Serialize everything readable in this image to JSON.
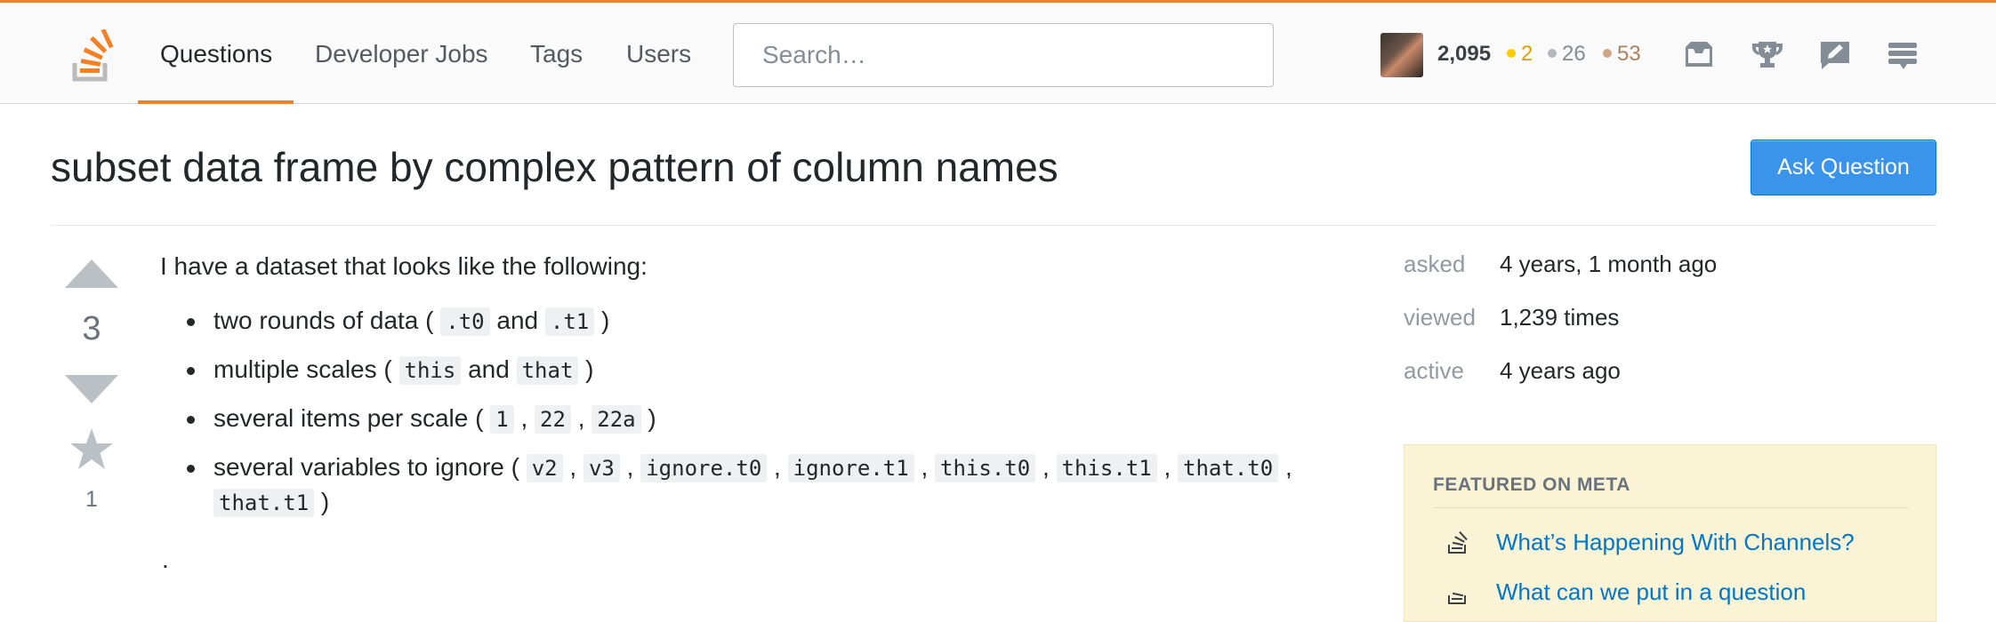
{
  "nav": {
    "items": [
      {
        "label": "Questions"
      },
      {
        "label": "Developer Jobs"
      },
      {
        "label": "Tags"
      },
      {
        "label": "Users"
      }
    ],
    "search_placeholder": "Search…",
    "user": {
      "reputation": "2,095",
      "gold": "2",
      "silver": "26",
      "bronze": "53"
    }
  },
  "question": {
    "title": "subset data frame by complex pattern of column names",
    "ask_button": "Ask Question",
    "votes": "3",
    "favorites": "1",
    "intro": "I have a dataset that looks like the following:",
    "bullets": [
      {
        "parts": [
          {
            "t": "text",
            "v": "two rounds of data ( "
          },
          {
            "t": "code",
            "v": ".t0"
          },
          {
            "t": "text",
            "v": " and "
          },
          {
            "t": "code",
            "v": ".t1"
          },
          {
            "t": "text",
            "v": " )"
          }
        ]
      },
      {
        "parts": [
          {
            "t": "text",
            "v": "multiple scales ( "
          },
          {
            "t": "code",
            "v": "this"
          },
          {
            "t": "text",
            "v": " and "
          },
          {
            "t": "code",
            "v": "that"
          },
          {
            "t": "text",
            "v": " )"
          }
        ]
      },
      {
        "parts": [
          {
            "t": "text",
            "v": "several items per scale ( "
          },
          {
            "t": "code",
            "v": "1"
          },
          {
            "t": "text",
            "v": " , "
          },
          {
            "t": "code",
            "v": "22"
          },
          {
            "t": "text",
            "v": " , "
          },
          {
            "t": "code",
            "v": "22a"
          },
          {
            "t": "text",
            "v": " )"
          }
        ]
      },
      {
        "parts": [
          {
            "t": "text",
            "v": "several variables to ignore ( "
          },
          {
            "t": "code",
            "v": "v2"
          },
          {
            "t": "text",
            "v": " , "
          },
          {
            "t": "code",
            "v": "v3"
          },
          {
            "t": "text",
            "v": " , "
          },
          {
            "t": "code",
            "v": "ignore.t0"
          },
          {
            "t": "text",
            "v": " , "
          },
          {
            "t": "code",
            "v": "ignore.t1"
          },
          {
            "t": "text",
            "v": " , "
          },
          {
            "t": "code",
            "v": "this.t0"
          },
          {
            "t": "text",
            "v": " , "
          },
          {
            "t": "code",
            "v": "this.t1"
          },
          {
            "t": "text",
            "v": " , "
          },
          {
            "t": "code",
            "v": "that.t0"
          },
          {
            "t": "text",
            "v": " , "
          },
          {
            "t": "code",
            "v": "that.t1"
          },
          {
            "t": "text",
            "v": " )"
          }
        ]
      }
    ],
    "trailing": "."
  },
  "sidebar": {
    "asked_label": "asked",
    "asked_value": "4 years, 1 month ago",
    "viewed_label": "viewed",
    "viewed_value": "1,239 times",
    "active_label": "active",
    "active_value": "4 years ago",
    "featured_title": "FEATURED ON META",
    "featured_links": [
      "What’s Happening With Channels?",
      "What can we put in a question"
    ]
  },
  "icons": {
    "logo": "stackoverflow-logo",
    "inbox": "inbox-icon",
    "achievements": "trophy-icon",
    "review": "review-icon",
    "site_switcher": "site-switcher-icon"
  },
  "colors": {
    "accent": "#f48024",
    "link": "#0077cc",
    "button": "#3a94ec",
    "featured_bg": "#fbf3d5"
  }
}
